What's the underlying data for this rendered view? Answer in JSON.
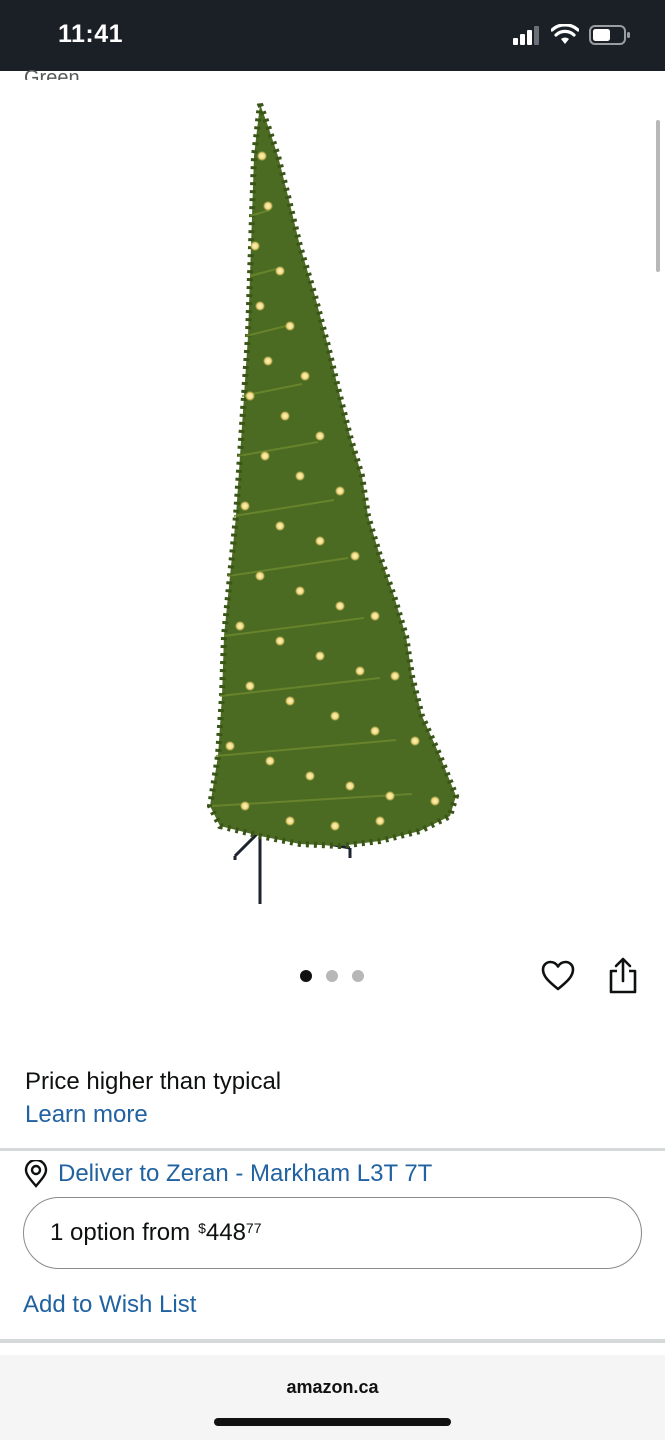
{
  "status_bar": {
    "time": "11:41",
    "icons": [
      "signal-icon",
      "wifi-icon",
      "battery-icon"
    ]
  },
  "product": {
    "cut_off_label": "Green",
    "image_alt": "half christmas tree with warm white lights",
    "carousel": {
      "count": 3,
      "active_index": 0
    }
  },
  "price_note": "Price higher than typical",
  "learn_more": "Learn more",
  "delivery": {
    "text": "Deliver to Zeran - Markham L3T 7T",
    "icon": "location-pin-icon"
  },
  "option": {
    "label": "1 option from",
    "currency": "$",
    "dollars": "448",
    "cents": "77"
  },
  "wishlist_label": "Add to Wish List",
  "browser": {
    "domain": "amazon.ca"
  },
  "colors": {
    "link": "#2162a1",
    "status_bar_bg": "#1b1f26",
    "divider": "#d5d9d9"
  }
}
